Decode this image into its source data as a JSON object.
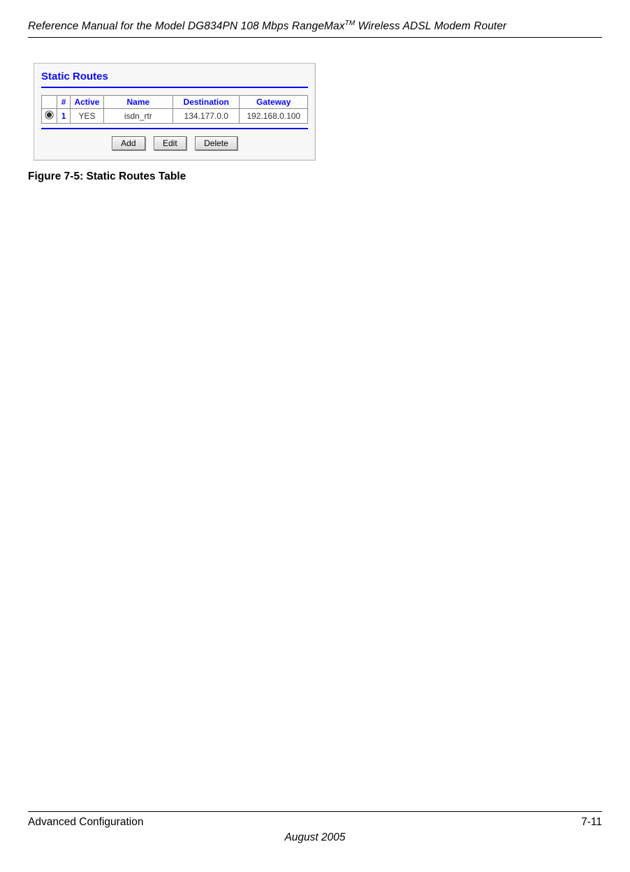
{
  "header": {
    "title_prefix": "Reference Manual for the Model DG834PN 108 Mbps RangeMax",
    "title_suffix": " Wireless ADSL Modem Router",
    "tm": "TM"
  },
  "screenshot": {
    "panel_title": "Static Routes",
    "table": {
      "headers": {
        "radio": "",
        "num": "#",
        "active": "Active",
        "name": "Name",
        "destination": "Destination",
        "gateway": "Gateway"
      },
      "rows": [
        {
          "selected": true,
          "num": "1",
          "active": "YES",
          "name": "isdn_rtr",
          "destination": "134.177.0.0",
          "gateway": "192.168.0.100"
        }
      ]
    },
    "buttons": {
      "add": "Add",
      "edit": "Edit",
      "delete": "Delete"
    }
  },
  "figure_caption": "Figure 7-5:  Static Routes Table",
  "footer": {
    "left": "Advanced Configuration",
    "right": "7-11",
    "date": "August 2005"
  }
}
